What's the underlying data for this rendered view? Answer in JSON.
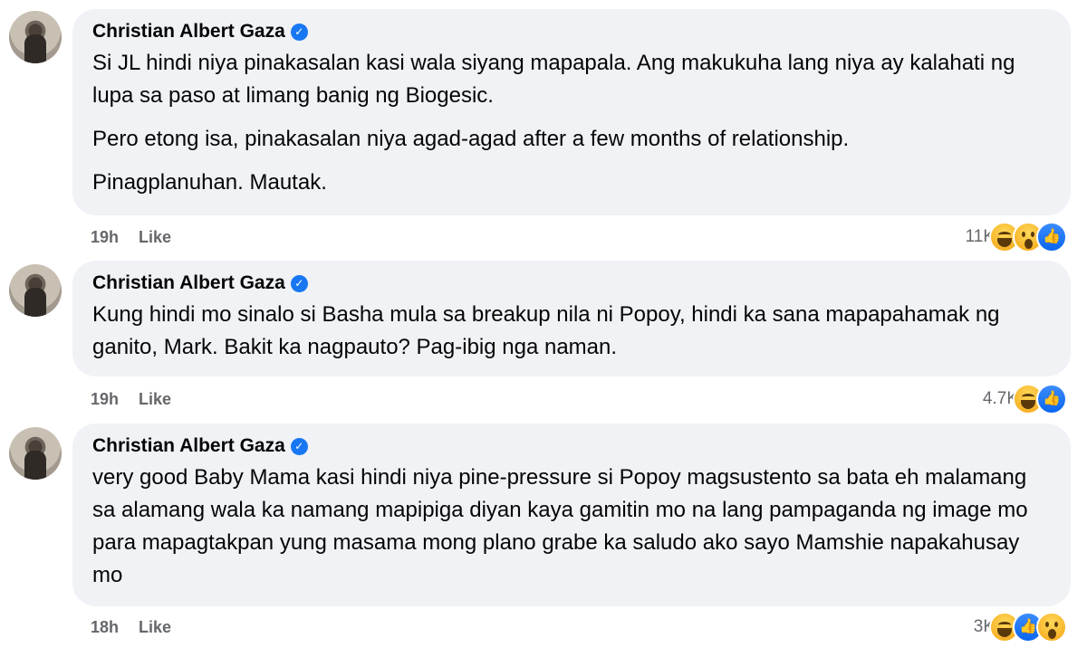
{
  "comments": [
    {
      "author": "Christian Albert Gaza",
      "paragraphs": [
        "Si JL hindi niya pinakasalan kasi wala siyang mapapala. Ang makukuha lang niya ay kalahati ng lupa sa paso at limang banig ng Biogesic.",
        "Pero etong isa, pinakasalan niya agad-agad after a few months of relationship.",
        "Pinagplanuhan. Mautak."
      ],
      "time": "19h",
      "like_label": "Like",
      "reaction_count": "11K",
      "reactions": [
        "haha",
        "wow",
        "like"
      ]
    },
    {
      "author": "Christian Albert Gaza",
      "paragraphs": [
        "Kung hindi mo sinalo si Basha mula sa breakup nila ni Popoy, hindi ka sana mapapahamak ng ganito, Mark. Bakit ka nagpauto? Pag-ibig nga naman."
      ],
      "time": "19h",
      "like_label": "Like",
      "reaction_count": "4.7K",
      "reactions": [
        "haha",
        "like"
      ]
    },
    {
      "author": "Christian Albert Gaza",
      "paragraphs": [
        "very good Baby Mama kasi hindi niya pine-pressure si Popoy magsustento sa bata eh malamang sa alamang wala ka namang mapipiga diyan kaya gamitin mo na lang pampaganda ng image mo para mapagtakpan yung masama mong plano grabe ka saludo ako sayo Mamshie napakahusay mo"
      ],
      "time": "18h",
      "like_label": "Like",
      "reaction_count": "3K",
      "reactions": [
        "haha",
        "like",
        "wow"
      ]
    }
  ],
  "colors": {
    "bubble": "#f0f2f5",
    "meta_text": "#65676b",
    "verified_badge": "#1877f2"
  }
}
